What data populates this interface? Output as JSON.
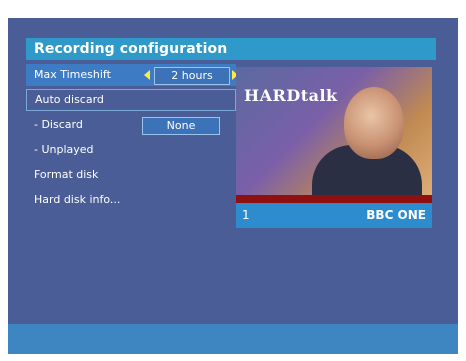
{
  "header": {
    "title": "Recording configuration"
  },
  "menu": {
    "max_timeshift": {
      "label": "Max Timeshift",
      "value": "2 hours"
    },
    "auto_discard": {
      "label": "Auto discard"
    },
    "discard": {
      "label": "- Discard",
      "value": "None"
    },
    "unplayed": {
      "label": "- Unplayed"
    },
    "format_disk": {
      "label": "Format disk"
    },
    "hard_disk_info": {
      "label": "Hard disk info..."
    }
  },
  "preview": {
    "channel_number": "1",
    "channel_name": "BBC ONE",
    "logo_text": "HARDtalk"
  },
  "colors": {
    "panel": "#4a5d96",
    "title_bar": "#2f9ac9",
    "arrow": "#ffe94a",
    "channel_bar": "#2d8ccd"
  },
  "icons": {
    "left_arrow": "arrow-left-icon",
    "right_arrow": "arrow-right-icon"
  }
}
